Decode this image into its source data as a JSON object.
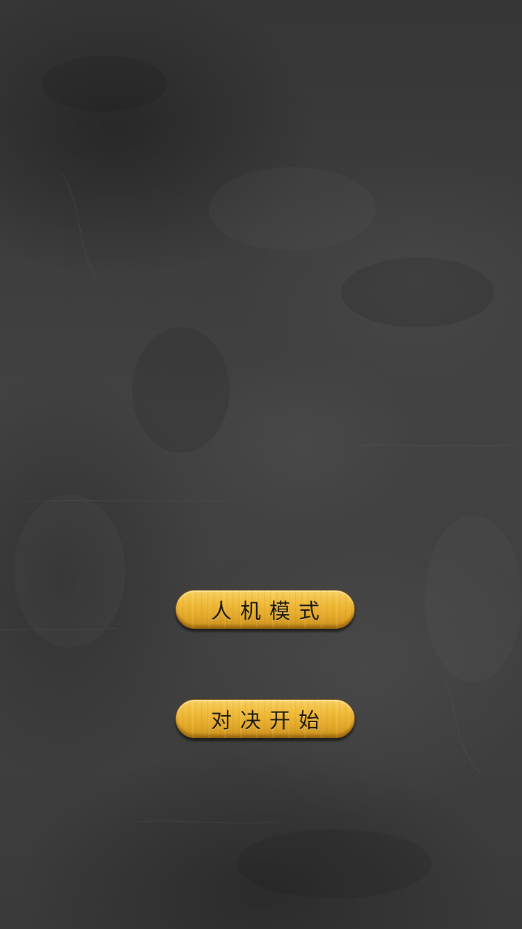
{
  "menu": {
    "vs_computer_label": "人机模式",
    "duel_start_label": "对决开始"
  },
  "colors": {
    "background": "#3f3f3f",
    "button_face": "#f0bb3a",
    "button_text": "#1e1608"
  }
}
